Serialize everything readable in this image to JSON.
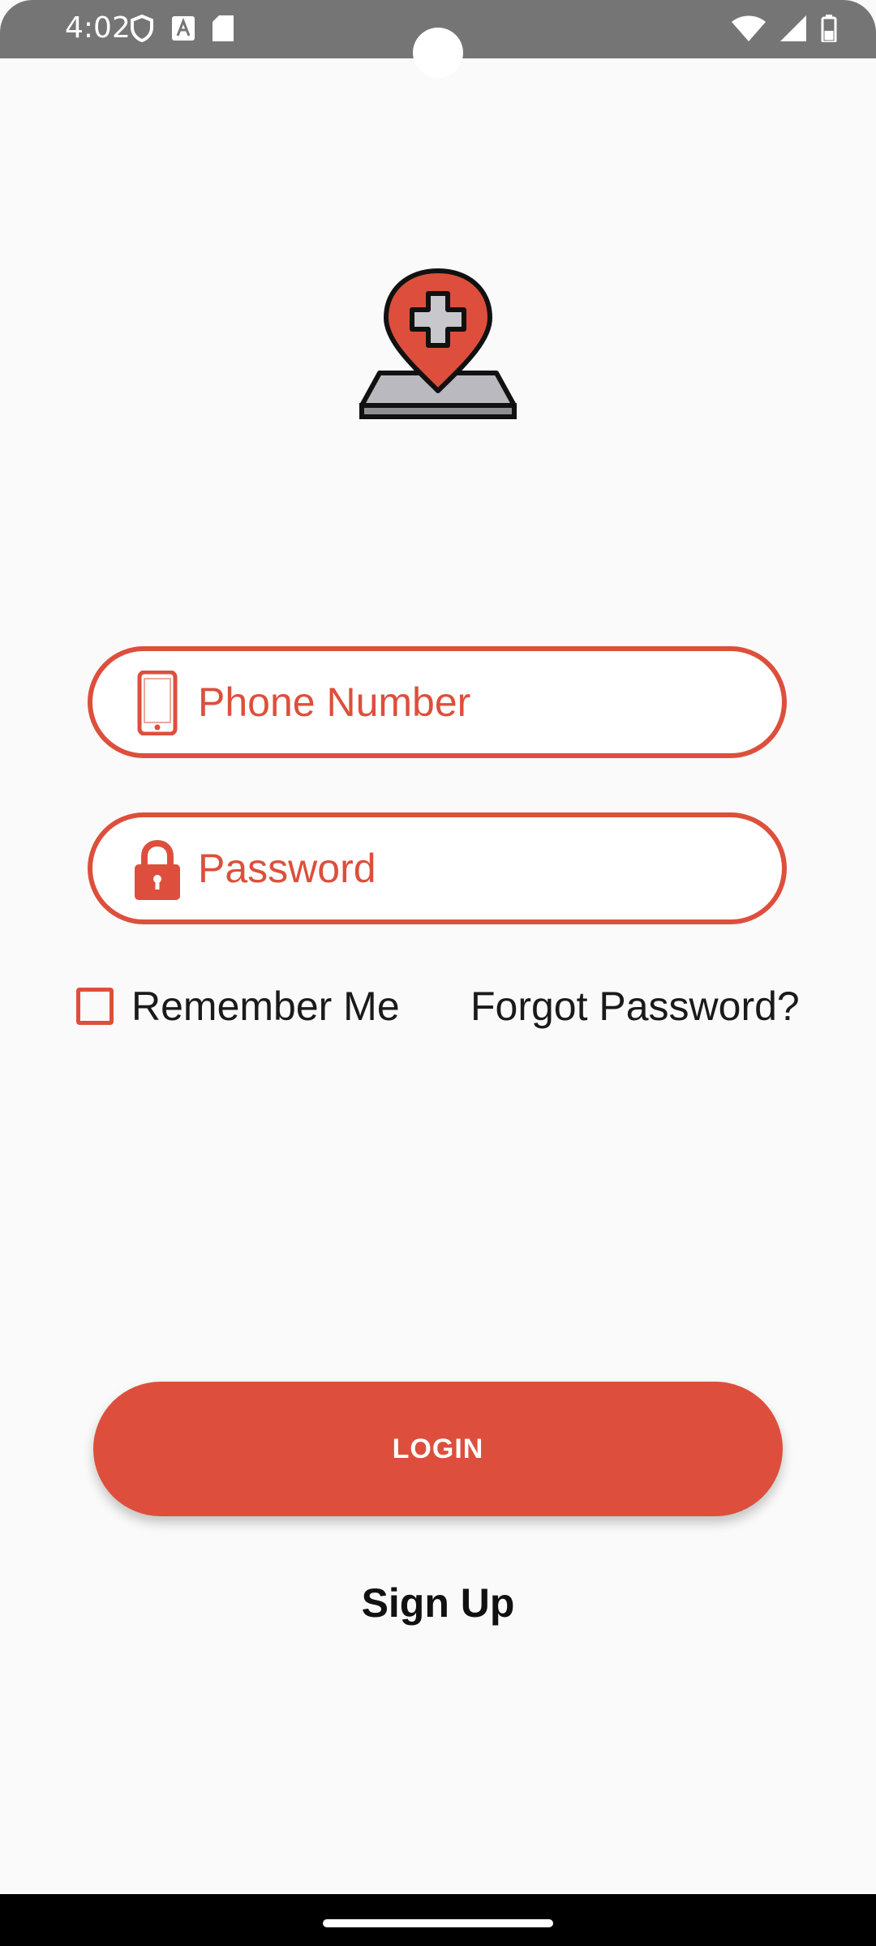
{
  "status_bar": {
    "time": "4:02",
    "left_icons": [
      "shield-icon",
      "text-a-icon",
      "sd-card-icon"
    ],
    "right_icons": [
      "wifi-icon",
      "signal-icon",
      "battery-icon"
    ]
  },
  "logo": {
    "icon": "medical-location-pin-icon",
    "colors": {
      "pin": "#dd4f3c",
      "base": "#b9b9bf",
      "cross": "#c7c7cc"
    }
  },
  "form": {
    "phone": {
      "placeholder": "Phone Number",
      "value": "",
      "icon": "phone-icon"
    },
    "password": {
      "placeholder": "Password",
      "value": "",
      "icon": "lock-icon"
    },
    "remember_label": "Remember Me",
    "remember_checked": false,
    "forgot_label": "Forgot Password?",
    "login_label": "LOGIN",
    "signup_label": "Sign Up"
  },
  "colors": {
    "accent": "#dd4f3c",
    "status_bar": "#757575",
    "background": "#fafafa"
  }
}
